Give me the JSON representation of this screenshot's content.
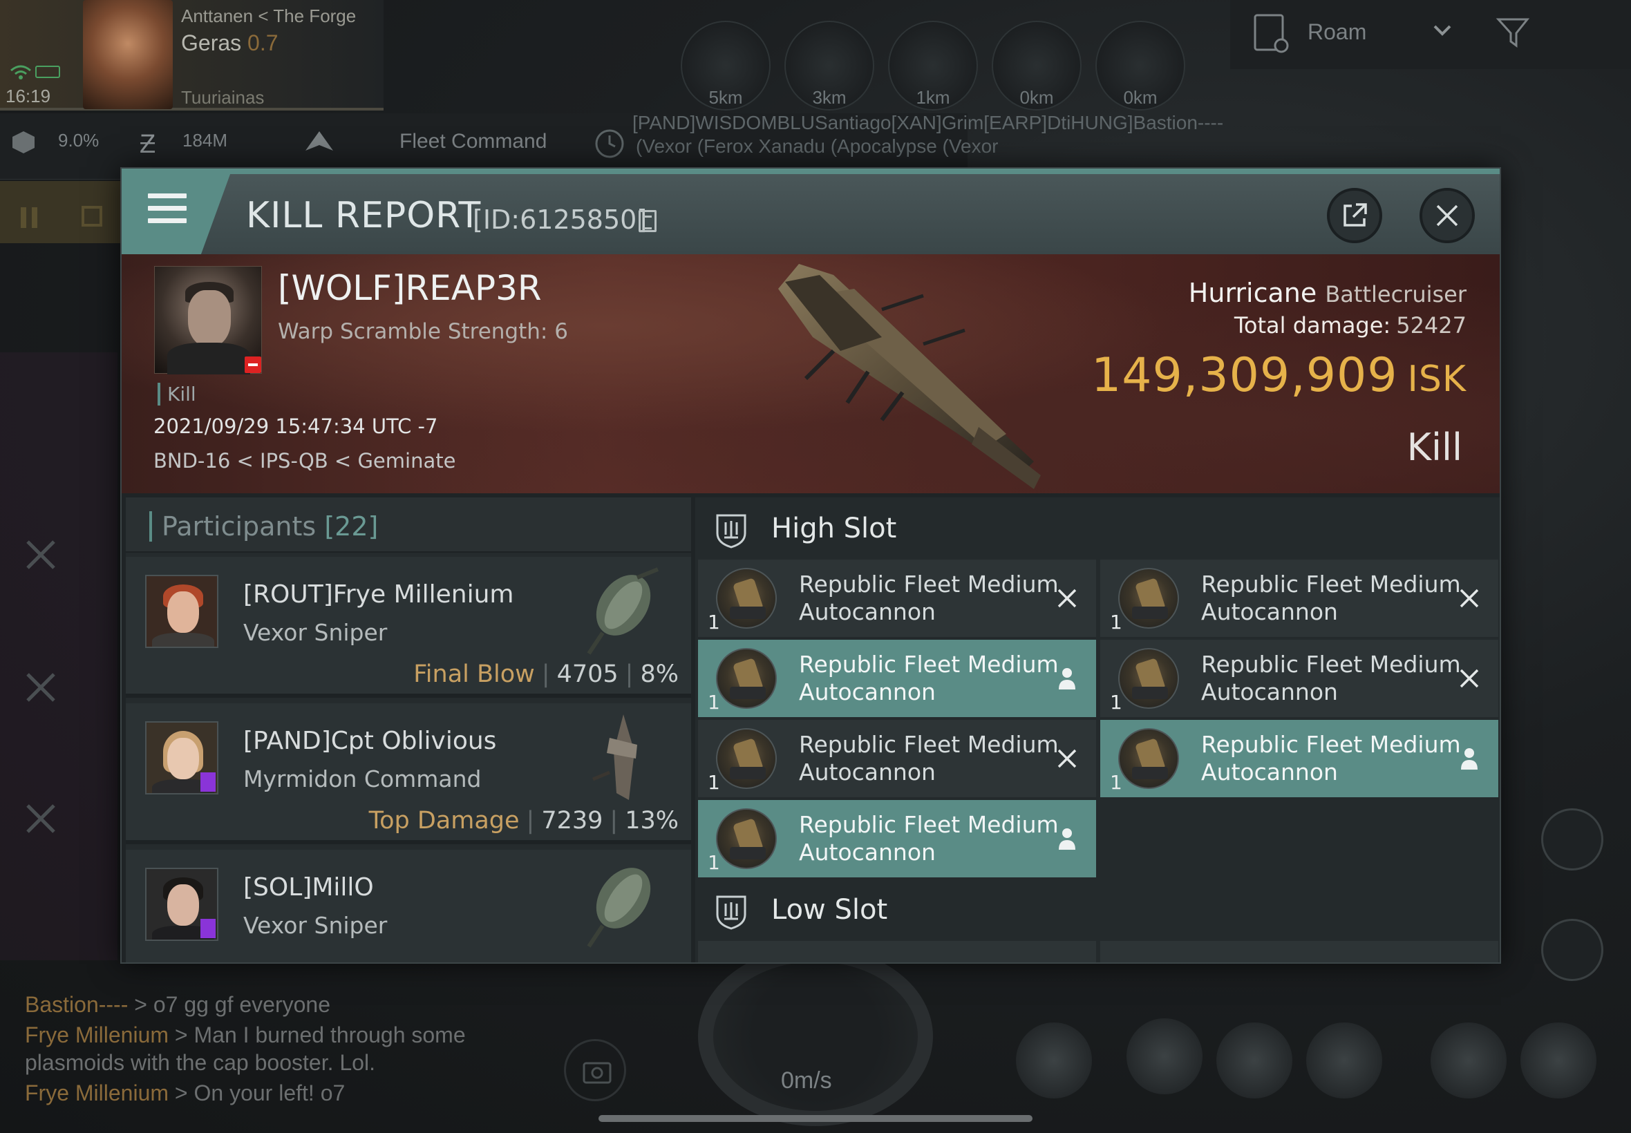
{
  "hud": {
    "region": "Anttanen",
    "constellation_sep": "<",
    "constellation": "The Forge",
    "system": "Geras",
    "security": "0.7",
    "station": "Tuuriainas",
    "time": "16:19",
    "cargo_pct": "9.0%",
    "isk": "184M",
    "fleet_command": "Fleet Command",
    "roam_label": "Roam"
  },
  "fleet_members": [
    {
      "dist": "5km"
    },
    {
      "dist": "3km"
    },
    {
      "dist": "1km"
    },
    {
      "dist": "0km"
    },
    {
      "dist": "0km"
    }
  ],
  "fleet_names_line": "[PAND]WISDOMBLUSantiago[XAN]Grim[EARP]DtiHUNG]Bastion----",
  "fleet_ships_line": "(Vexor   (Ferox   Xanadu  (Apocalypse  (Vexor",
  "kill_report": {
    "title": "KILL REPORT",
    "id": "[ID:6125850]",
    "victim": {
      "name": "[WOLF]REAP3R",
      "scram": "Warp Scramble Strength: 6",
      "kill_tag": "Kill",
      "datetime": "2021/09/29 15:47:34 UTC -7",
      "location": "BND-16 < IPS-QB < Geminate"
    },
    "ship": {
      "name": "Hurricane",
      "class": "Battlecruiser",
      "total_damage_label": "Total damage:",
      "total_damage": "52427",
      "isk_value": "149,309,909",
      "isk_unit": "ISK",
      "result": "Kill"
    },
    "participants": {
      "label": "Participants",
      "count": "[22]",
      "rows": [
        {
          "name": "[ROUT]Frye Millenium",
          "ship": "Vexor Sniper",
          "tag": "Final Blow",
          "damage": "4705",
          "pct": "8%"
        },
        {
          "name": "[PAND]Cpt Oblivious",
          "ship": "Myrmidon Command",
          "tag": "Top Damage",
          "damage": "7239",
          "pct": "13%"
        },
        {
          "name": "[SOL]MillO",
          "ship": "Vexor Sniper",
          "tag": "",
          "damage": "",
          "pct": ""
        }
      ]
    },
    "high_slot": {
      "label": "High Slot",
      "modules": [
        {
          "qty": "1",
          "name": "Republic Fleet Medium Autocannon",
          "status": "destroyed"
        },
        {
          "qty": "1",
          "name": "Republic Fleet Medium Autocannon",
          "status": "destroyed"
        },
        {
          "qty": "1",
          "name": "Republic Fleet Medium Autocannon",
          "status": "dropped"
        },
        {
          "qty": "1",
          "name": "Republic Fleet Medium Autocannon",
          "status": "destroyed"
        },
        {
          "qty": "1",
          "name": "Republic Fleet Medium Autocannon",
          "status": "destroyed"
        },
        {
          "qty": "1",
          "name": "Republic Fleet Medium Autocannon",
          "status": "dropped"
        },
        {
          "qty": "1",
          "name": "Republic Fleet Medium Autocannon",
          "status": "dropped"
        }
      ]
    },
    "low_slot": {
      "label": "Low Slot"
    }
  },
  "chat": [
    {
      "who": "Bastion----",
      "msg": " > o7 gg gf everyone"
    },
    {
      "who": "Frye Millenium",
      "msg": " > Man I burned through some plasmoids with the cap booster. Lol."
    },
    {
      "who": "Frye Millenium",
      "msg": " > On your left! o7"
    }
  ],
  "speed": "0m/s",
  "colors": {
    "accent_teal": "#5a8c86",
    "isk_gold": "#e6b24a",
    "tag_gold": "#c8a062"
  }
}
